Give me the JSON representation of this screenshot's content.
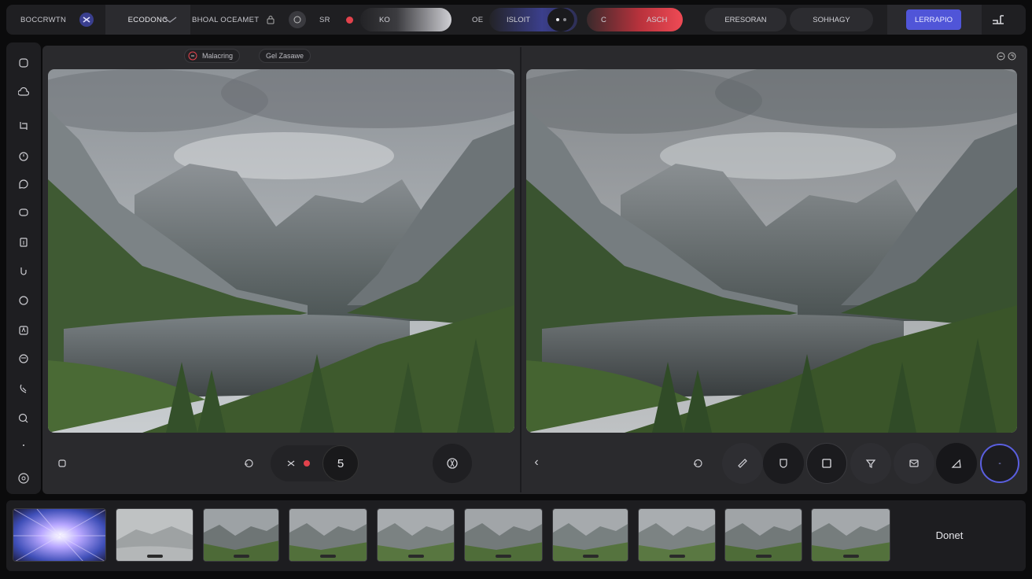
{
  "toolbar": {
    "app_name": "BOCCRWTN",
    "mode_label": "ECODONC",
    "doc_name": "BHOAL OCEAMET",
    "sr_label": "SR",
    "slider_label": "KO",
    "oe_label": "OE",
    "isloit_label": "ISLOIT",
    "c_label": "C",
    "asch_label": "ASCH",
    "preset_label": "ERESORAN",
    "summary_label": "SOHHAGY",
    "export_label": "LERRAPIO",
    "colors": {
      "accent": "#5055d8",
      "red": "#e2424c",
      "violet": "#3b3f8c"
    }
  },
  "rail": {
    "icons": [
      "shield-icon",
      "cloud-icon",
      "crop-icon",
      "timer-icon",
      "chat-icon",
      "layers-icon",
      "frame-icon",
      "hand-icon",
      "circle-icon",
      "text-icon",
      "palette-icon",
      "brush-icon",
      "search-icon",
      "dots-icon",
      "settings-icon"
    ]
  },
  "left_pane": {
    "status_chip": "Malacring",
    "info_chip": "Gel Zasawe",
    "counter": "5"
  },
  "right_pane": {
    "back": "‹",
    "ring_label": "-"
  },
  "filmstrip": {
    "thumb_count": 10,
    "done_label": "Donet"
  }
}
